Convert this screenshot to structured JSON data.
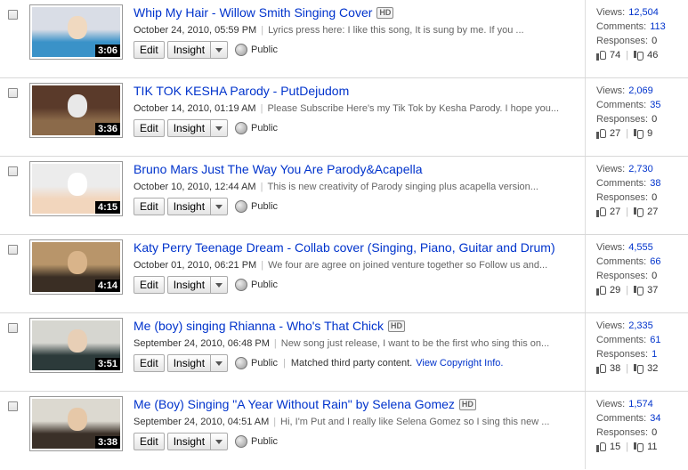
{
  "videos": [
    {
      "title": "Whip My Hair - Willow Smith Singing Cover",
      "hd": "HD",
      "date": "October 24, 2010, 05:59 PM",
      "desc": "Lyrics press here: I like this song, It is sung by me. If you ...",
      "duration": "3:06",
      "privacy": "Public",
      "views": "12,504",
      "comments": "113",
      "responses": "0",
      "likes": "74",
      "dislikes": "46",
      "thumb_colors": [
        "#d9dde6",
        "#3a92c8",
        "#f0d9c0"
      ]
    },
    {
      "title": "TIK TOK KESHA Parody - PutDejudom",
      "hd": "",
      "date": "October 14, 2010, 01:19 AM",
      "desc": "Please Subscribe Here's my Tik Tok by Kesha Parody. I hope you...",
      "duration": "3:36",
      "privacy": "Public",
      "views": "2,069",
      "comments": "35",
      "responses": "0",
      "likes": "27",
      "dislikes": "9",
      "thumb_colors": [
        "#5a3a2a",
        "#8b6a4a",
        "#e8e8e8"
      ]
    },
    {
      "title": "Bruno Mars Just The Way You Are Parody&Acapella",
      "hd": "",
      "date": "October 10, 2010, 12:44 AM",
      "desc": "This is new creativity of Parody singing plus acapella version...",
      "duration": "4:15",
      "privacy": "Public",
      "views": "2,730",
      "comments": "38",
      "responses": "0",
      "likes": "27",
      "dislikes": "27",
      "thumb_colors": [
        "#ececec",
        "#f2d6bd",
        "#ffffff"
      ]
    },
    {
      "title": "Katy Perry Teenage Dream - Collab cover (Singing, Piano, Guitar and Drum)",
      "hd": "",
      "date": "October 01, 2010, 06:21 PM",
      "desc": "We four are agree on joined venture together so Follow us and...",
      "duration": "4:14",
      "privacy": "Public",
      "views": "4,555",
      "comments": "66",
      "responses": "0",
      "likes": "29",
      "dislikes": "37",
      "thumb_colors": [
        "#b8956a",
        "#3a2e24",
        "#d9b48a"
      ]
    },
    {
      "title": "Me (boy) singing Rhianna - Who's That Chick",
      "hd": "HD",
      "date": "September 24, 2010, 06:48 PM",
      "desc": "New song just release, I want to be the first who sing this on...",
      "duration": "3:51",
      "privacy": "Public",
      "matched": "Matched third party content.",
      "copyright": "View Copyright Info.",
      "views": "2,335",
      "comments": "61",
      "responses": "1",
      "likes": "38",
      "dislikes": "32",
      "thumb_colors": [
        "#d6d6d0",
        "#2c3a3a",
        "#e8cfb6"
      ]
    },
    {
      "title": "Me (Boy) Singing \"A Year Without Rain\" by Selena Gomez",
      "hd": "HD",
      "date": "September 24, 2010, 04:51 AM",
      "desc": "Hi, I'm Put and I really like Selena Gomez so I sing this new ...",
      "duration": "3:38",
      "privacy": "Public",
      "views": "1,574",
      "comments": "34",
      "responses": "0",
      "likes": "15",
      "dislikes": "11",
      "thumb_colors": [
        "#dcd9d0",
        "#3a3028",
        "#e6c8a8"
      ]
    }
  ],
  "labels": {
    "edit": "Edit",
    "insight": "Insight",
    "views": "Views:",
    "comments": "Comments:",
    "responses": "Responses:"
  }
}
